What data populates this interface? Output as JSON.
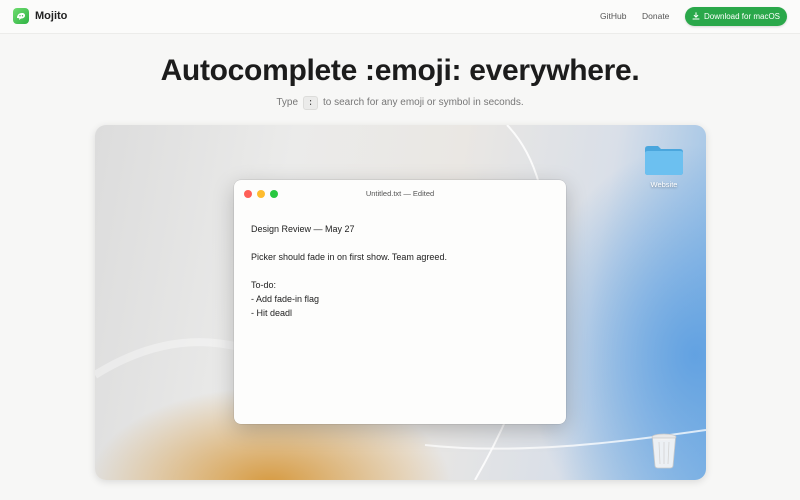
{
  "header": {
    "brand": "Mojito",
    "nav": {
      "github": "GitHub",
      "donate": "Donate"
    },
    "download_label": "Download for macOS"
  },
  "hero": {
    "title": "Autocomplete :emoji: everywhere.",
    "subtitle_before": "Type",
    "subtitle_key": ":",
    "subtitle_after": "to search for any emoji or symbol in seconds."
  },
  "desktop": {
    "folder_label": "Website",
    "window": {
      "title": "Untitled.txt — Edited",
      "lines": [
        "Design Review — May 27",
        "",
        "Picker should fade in on first show. Team agreed.",
        "",
        "To-do:",
        "- Add fade-in flag",
        "- Hit deadl"
      ]
    }
  },
  "colors": {
    "accent": "#2aa84a",
    "traffic_close": "#fe5f57",
    "traffic_minimize": "#febc2e",
    "traffic_zoom": "#28c840",
    "folder_blue": "#5fb6ea"
  },
  "icons": [
    "mojito-logo-icon",
    "download-icon",
    "folder-icon",
    "trash-icon"
  ]
}
